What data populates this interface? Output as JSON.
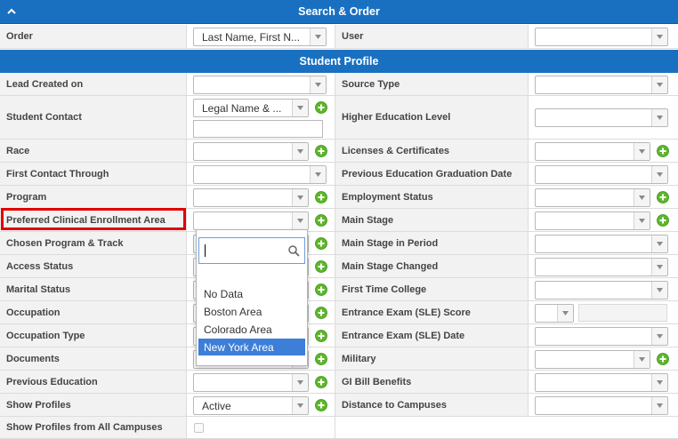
{
  "search_order": {
    "title": "Search & Order",
    "order_label": "Order",
    "order_value": "Last Name, First N...",
    "user_label": "User",
    "user_value": ""
  },
  "student_profile": {
    "title": "Student Profile",
    "left": [
      {
        "label": "Lead Created on",
        "value": ""
      },
      {
        "label": "Student Contact",
        "value": "Legal Name & ..."
      },
      {
        "label": "Race",
        "value": ""
      },
      {
        "label": "First Contact Through",
        "value": ""
      },
      {
        "label": "Program",
        "value": ""
      },
      {
        "label": "Preferred Clinical Enrollment Area",
        "value": ""
      },
      {
        "label": "Chosen Program & Track",
        "value": ""
      },
      {
        "label": "Access Status",
        "value": ""
      },
      {
        "label": "Marital Status",
        "value": ""
      },
      {
        "label": "Occupation",
        "value": ""
      },
      {
        "label": "Occupation Type",
        "value": ""
      },
      {
        "label": "Documents",
        "value": ""
      },
      {
        "label": "Previous Education",
        "value": ""
      },
      {
        "label": "Show Profiles",
        "value": "Active"
      },
      {
        "label": "Show Profiles from All Campuses",
        "value": ""
      }
    ],
    "right": [
      {
        "label": "Source Type",
        "value": ""
      },
      {
        "label": "Higher Education Level",
        "value": ""
      },
      {
        "label": "Licenses & Certificates",
        "value": ""
      },
      {
        "label": "Previous Education Graduation Date",
        "value": ""
      },
      {
        "label": "Employment Status",
        "value": ""
      },
      {
        "label": "Main Stage",
        "value": ""
      },
      {
        "label": "Main Stage in Period",
        "value": ""
      },
      {
        "label": "Main Stage Changed",
        "value": ""
      },
      {
        "label": "First Time College",
        "value": ""
      },
      {
        "label": "Entrance Exam (SLE) Score",
        "value": ""
      },
      {
        "label": "Entrance Exam (SLE) Date",
        "value": ""
      },
      {
        "label": "Military",
        "value": ""
      },
      {
        "label": "GI Bill Benefits",
        "value": ""
      },
      {
        "label": "Distance to Campuses",
        "value": ""
      }
    ]
  },
  "dropdown": {
    "search_value": "",
    "options": [
      "No Data",
      "Boston Area",
      "Colorado Area",
      "New York Area"
    ],
    "selected": "New York Area"
  },
  "colors": {
    "header_blue": "#1a70c0",
    "add_green": "#5cb82a",
    "highlight_red": "#e00000",
    "selected_blue": "#3c7ed8"
  }
}
